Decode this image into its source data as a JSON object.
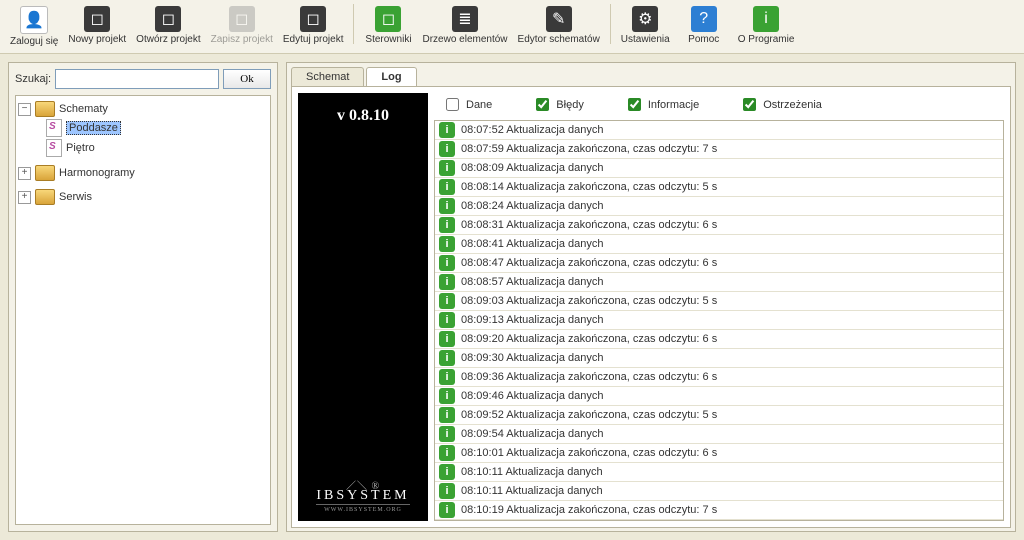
{
  "toolbar": [
    {
      "label": "Zaloguj się",
      "icon": "👤",
      "cls": "ic-white",
      "enabled": true
    },
    {
      "label": "Nowy projekt",
      "icon": "◻",
      "cls": "ic-dark",
      "enabled": true
    },
    {
      "label": "Otwórz projekt",
      "icon": "◻",
      "cls": "ic-dark",
      "enabled": true
    },
    {
      "label": "Zapisz projekt",
      "icon": "◻",
      "cls": "ic-grey",
      "enabled": false
    },
    {
      "label": "Edytuj projekt",
      "icon": "◻",
      "cls": "ic-dark",
      "enabled": true
    },
    {
      "sep": true
    },
    {
      "label": "Sterowniki",
      "icon": "◻",
      "cls": "ic-green",
      "enabled": true
    },
    {
      "label": "Drzewo elementów",
      "icon": "≣",
      "cls": "ic-dark",
      "enabled": true
    },
    {
      "label": "Edytor schematów",
      "icon": "✎",
      "cls": "ic-dark",
      "enabled": true
    },
    {
      "sep": true
    },
    {
      "label": "Ustawienia",
      "icon": "⚙",
      "cls": "ic-dark",
      "enabled": true
    },
    {
      "label": "Pomoc",
      "icon": "?",
      "cls": "ic-blue",
      "enabled": true
    },
    {
      "label": "O Programie",
      "icon": "i",
      "cls": "ic-green",
      "enabled": true
    }
  ],
  "search": {
    "label": "Szukaj:",
    "button": "Ok",
    "value": ""
  },
  "tree": {
    "schematy": {
      "label": "Schematy",
      "expanded": true,
      "children": [
        {
          "label": "Poddasze",
          "selected": true
        },
        {
          "label": "Piętro"
        }
      ]
    },
    "harmonogramy": {
      "label": "Harmonogramy"
    },
    "serwis": {
      "label": "Serwis"
    }
  },
  "tabs": [
    {
      "label": "Schemat",
      "active": false
    },
    {
      "label": "Log",
      "active": true
    }
  ],
  "version": "v 0.8.10",
  "brand": {
    "main": "IBSYSTEM",
    "sub": "WWW.IBSYSTEM.ORG",
    "reg": "®"
  },
  "filters": [
    {
      "label": "Dane",
      "checked": false
    },
    {
      "label": "Błędy",
      "checked": true
    },
    {
      "label": "Informacje",
      "checked": true
    },
    {
      "label": "Ostrzeżenia",
      "checked": true
    }
  ],
  "log": [
    "08:07:52 Aktualizacja danych",
    "08:07:59 Aktualizacja zakończona, czas odczytu: 7 s",
    "08:08:09 Aktualizacja danych",
    "08:08:14 Aktualizacja zakończona, czas odczytu: 5 s",
    "08:08:24 Aktualizacja danych",
    "08:08:31 Aktualizacja zakończona, czas odczytu: 6 s",
    "08:08:41 Aktualizacja danych",
    "08:08:47 Aktualizacja zakończona, czas odczytu: 6 s",
    "08:08:57 Aktualizacja danych",
    "08:09:03 Aktualizacja zakończona, czas odczytu: 5 s",
    "08:09:13 Aktualizacja danych",
    "08:09:20 Aktualizacja zakończona, czas odczytu: 6 s",
    "08:09:30 Aktualizacja danych",
    "08:09:36 Aktualizacja zakończona, czas odczytu: 6 s",
    "08:09:46 Aktualizacja danych",
    "08:09:52 Aktualizacja zakończona, czas odczytu: 5 s",
    "08:09:54 Aktualizacja danych",
    "08:10:01 Aktualizacja zakończona, czas odczytu: 6 s",
    "08:10:11 Aktualizacja danych",
    "08:10:11 Aktualizacja danych",
    "08:10:19 Aktualizacja zakończona, czas odczytu: 7 s"
  ]
}
